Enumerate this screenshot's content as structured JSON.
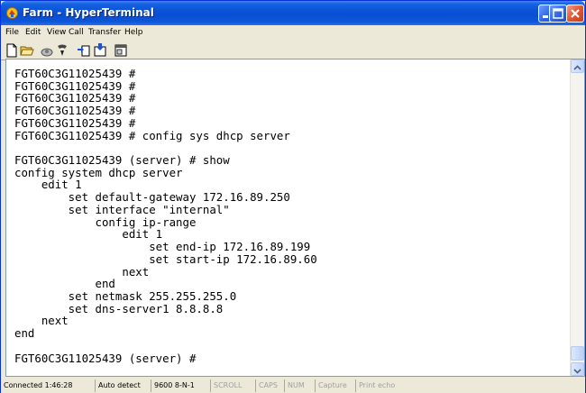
{
  "window": {
    "title": "Farm - HyperTerminal"
  },
  "menu": [
    "File",
    "Edit",
    "View",
    "Call",
    "Transfer",
    "Help"
  ],
  "toolbar": {
    "icons": [
      "new-connection-icon",
      "open-icon",
      "call-icon",
      "disconnect-icon",
      "send-icon",
      "receive-icon",
      "properties-icon"
    ]
  },
  "terminal": {
    "lines": [
      "FGT60C3G11025439 #",
      "FGT60C3G11025439 #",
      "FGT60C3G11025439 #",
      "FGT60C3G11025439 #",
      "FGT60C3G11025439 #",
      "FGT60C3G11025439 # config sys dhcp server",
      "",
      "FGT60C3G11025439 (server) # show",
      "config system dhcp server",
      "    edit 1",
      "        set default-gateway 172.16.89.250",
      "        set interface \"internal\"",
      "            config ip-range",
      "                edit 1",
      "                    set end-ip 172.16.89.199",
      "                    set start-ip 172.16.89.60",
      "                next",
      "            end",
      "        set netmask 255.255.255.0",
      "        set dns-server1 8.8.8.8",
      "    next",
      "end",
      "",
      "FGT60C3G11025439 (server) #"
    ]
  },
  "status": {
    "connected": "Connected 1:46:28",
    "detect": "Auto detect",
    "settings": "9600 8-N-1",
    "scroll": "SCROLL",
    "caps": "CAPS",
    "num": "NUM",
    "capture": "Capture",
    "print_echo": "Print echo"
  }
}
